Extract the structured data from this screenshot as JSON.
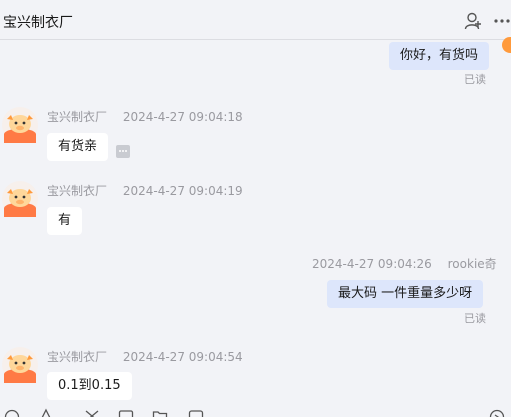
{
  "header": {
    "title": "宝兴制衣厂",
    "icons": [
      "add-user-icon",
      "more-icon"
    ]
  },
  "messages": [
    {
      "dir": "out",
      "text": "你好，有货吗",
      "status": "已读"
    },
    {
      "dir": "in",
      "sender": "宝兴制衣厂",
      "time": "2024-4-27 09:04:18",
      "text": "有货亲"
    },
    {
      "dir": "in",
      "sender": "宝兴制衣厂",
      "time": "2024-4-27 09:04:19",
      "text": "有"
    },
    {
      "dir": "out",
      "sender": "rookie奇",
      "time": "2024-4-27 09:04:26",
      "text": "最大码  一件重量多少呀",
      "status": "已读"
    },
    {
      "dir": "in",
      "sender": "宝兴制衣厂",
      "time": "2024-4-27 09:04:54",
      "text": "0.1到0.15"
    }
  ],
  "toolbar": {
    "icons": [
      "emoji-icon",
      "bell-icon",
      "scissors-icon",
      "image-icon",
      "folder-icon",
      "chat-icon",
      "send-arrow-icon"
    ]
  },
  "colors": {
    "background": "#f2f3f7",
    "bubble_in": "#ffffff",
    "bubble_out": "#dde6fb",
    "meta_text": "#9a9aa0",
    "avatar_orange": "#ff9a3c"
  }
}
